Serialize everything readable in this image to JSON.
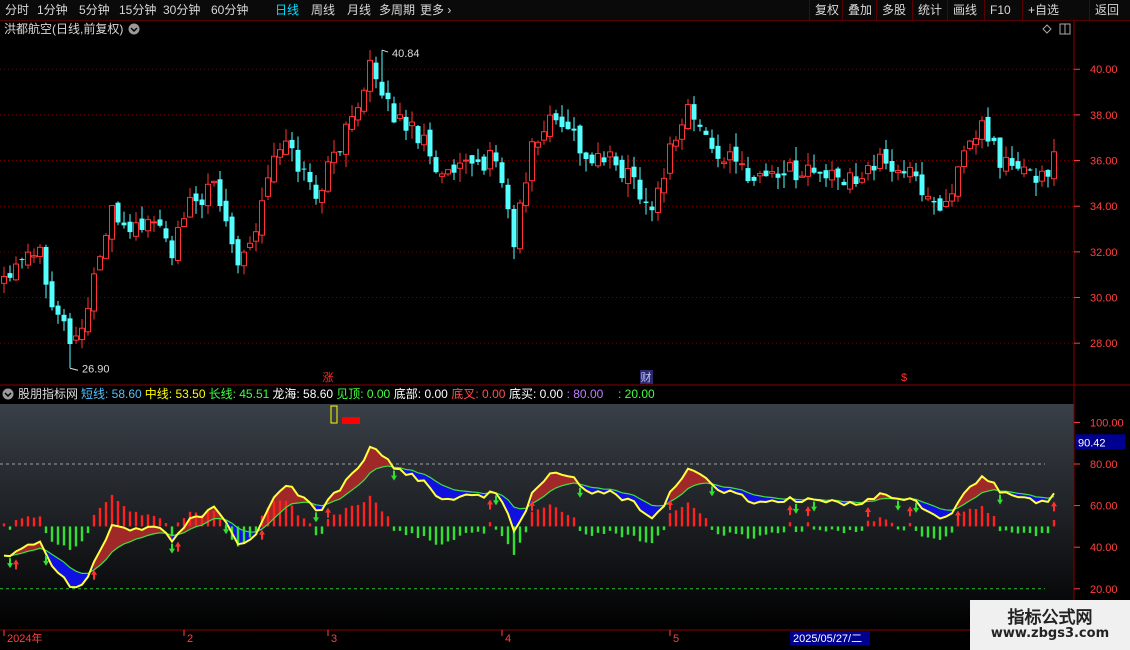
{
  "toolbar": {
    "periods": [
      "分时",
      "1分钟",
      "5分钟",
      "15分钟",
      "30分钟",
      "60分钟",
      "日线",
      "周线",
      "月线",
      "多周期",
      "更多"
    ],
    "active_period": "日线",
    "right_buttons": [
      "复权",
      "叠加",
      "多股",
      "统计",
      "画线",
      "F10",
      "+自选",
      "返回"
    ]
  },
  "stock_title": "洪都航空(日线,前复权)",
  "main_chart": {
    "price_axis_labels": [
      "40.00",
      "38.00",
      "36.00",
      "34.00",
      "32.00",
      "30.00",
      "28.00"
    ],
    "price_axis_values": [
      40,
      38,
      36,
      34,
      32,
      30,
      28
    ],
    "high_label": "40.84",
    "low_label": "26.90",
    "event_markers": [
      {
        "label": "涨",
        "index": 54,
        "color": "#ff3030"
      },
      {
        "label": "财",
        "index": 107,
        "color": "#c0c0ff"
      },
      {
        "label": "$",
        "index": 150,
        "color": "#ff3030"
      }
    ],
    "colors": {
      "up": "#ff3333",
      "down": "#54ffff",
      "grid": "#7a0000"
    }
  },
  "indicator": {
    "name": "股朋指标网",
    "params": [
      {
        "name": "短线:",
        "value": "58.60",
        "color": "#54c0ff"
      },
      {
        "name": "中线:",
        "value": "53.50",
        "color": "#ffff00"
      },
      {
        "name": "长线:",
        "value": "45.51",
        "color": "#40ff40"
      },
      {
        "name": "龙海:",
        "value": "58.60",
        "color": "#ffffff"
      },
      {
        "name": "见顶:",
        "value": "0.00",
        "color": "#40ff40"
      },
      {
        "name": "底部:",
        "value": "0.00",
        "color": "#ffffff"
      },
      {
        "name": "底叉:",
        "value": "0.00",
        "color": "#ff5050"
      },
      {
        "name": "底买:",
        "value": "0.00",
        "color": "#ffffff"
      },
      {
        "name": ":",
        "value": "80.00",
        "color": "#c080ff"
      },
      {
        "name": ":",
        "value": "20.00",
        "color": "#40ff40"
      }
    ],
    "axis_labels": [
      "100.00",
      "80.00",
      "60.00",
      "40.00",
      "20.00"
    ],
    "axis_values": [
      100,
      80,
      60,
      40,
      20
    ],
    "current_value_label": "90.42"
  },
  "date_axis": {
    "labels": [
      {
        "label": "2024年",
        "index": 0
      },
      {
        "label": "2",
        "index": 30
      },
      {
        "label": "3",
        "index": 54
      },
      {
        "label": "4",
        "index": 83
      },
      {
        "label": "5",
        "index": 111
      }
    ],
    "cursor_date": "2025/05/27/二"
  },
  "chart_data": {
    "type": "candlestick",
    "price_range": [
      27,
      41.5
    ],
    "high": 40.84,
    "low": 26.9,
    "oscillator_range": [
      5,
      105
    ],
    "levels": [
      80,
      20
    ]
  },
  "watermark": {
    "title": "指标公式网",
    "url": "www.zbgs3.com"
  }
}
